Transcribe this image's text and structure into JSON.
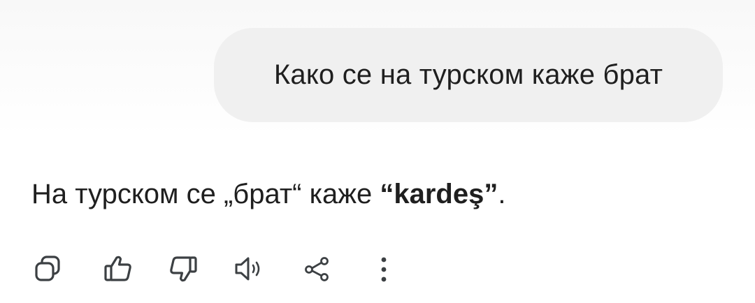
{
  "user_message": {
    "text": "Како се на турском каже брат"
  },
  "assistant_message": {
    "prefix": "На турском се „брат“ каже ",
    "open_quote": "“",
    "bold_word": "kardeş",
    "close_quote": "”",
    "suffix": "."
  },
  "actions": [
    {
      "name": "copy",
      "icon": "copy-icon"
    },
    {
      "name": "thumbs-up",
      "icon": "thumbs-up-icon"
    },
    {
      "name": "thumbs-down",
      "icon": "thumbs-down-icon"
    },
    {
      "name": "read-aloud",
      "icon": "speaker-icon"
    },
    {
      "name": "share",
      "icon": "share-icon"
    },
    {
      "name": "more",
      "icon": "more-vertical-icon"
    }
  ],
  "colors": {
    "icon": "#3c4043",
    "bubble": "#f0f0f0",
    "text": "#1f1f1f"
  }
}
